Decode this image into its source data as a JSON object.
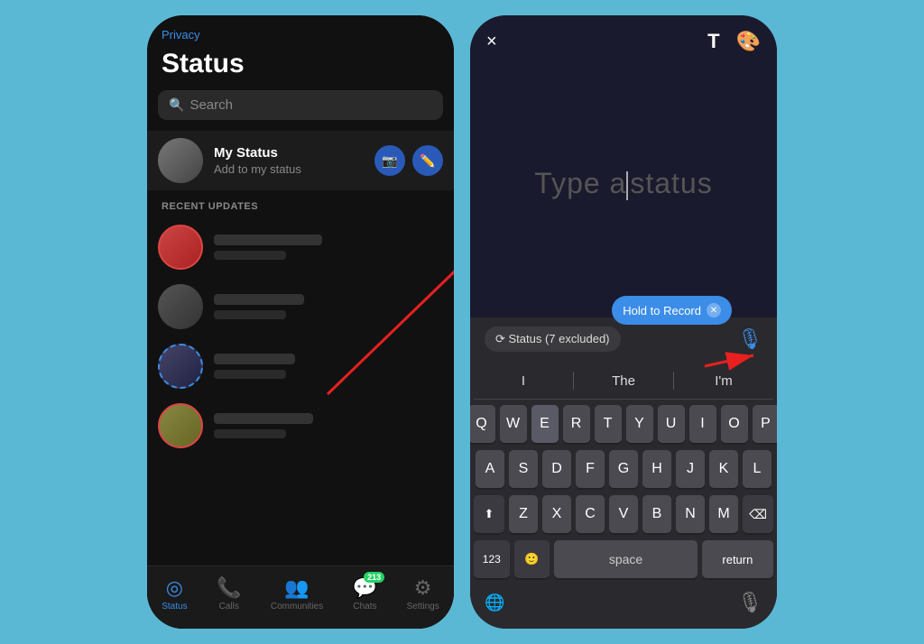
{
  "left_phone": {
    "privacy_label": "Privacy",
    "title": "Status",
    "search_placeholder": "Search",
    "my_status": {
      "name": "My Status",
      "sub": "Add to my status"
    },
    "section_label": "RECENT UPDATES",
    "updates": [
      {
        "id": 1,
        "ring": "pink"
      },
      {
        "id": 2,
        "ring": "none"
      },
      {
        "id": 3,
        "ring": "blue"
      },
      {
        "id": 4,
        "ring": "pink"
      }
    ],
    "nav": {
      "items": [
        {
          "label": "Status",
          "active": true,
          "icon": "◎"
        },
        {
          "label": "Calls",
          "active": false,
          "icon": "📞"
        },
        {
          "label": "Communities",
          "active": false,
          "icon": "👥"
        },
        {
          "label": "Chats",
          "active": false,
          "icon": "💬",
          "badge": "213"
        },
        {
          "label": "Settings",
          "active": false,
          "icon": "⚙"
        }
      ]
    }
  },
  "right_phone": {
    "close_label": "×",
    "text_label": "T",
    "palette_label": "🎨",
    "placeholder_text": "Type a",
    "placeholder_text2": "status",
    "hold_to_record": "Hold to Record",
    "status_excluded": "⟳ Status (7 excluded)",
    "word_suggestions": [
      "I",
      "The",
      "I'm"
    ],
    "keyboard_rows": [
      [
        "Q",
        "W",
        "E",
        "R",
        "T",
        "Y",
        "U",
        "I",
        "O",
        "P"
      ],
      [
        "A",
        "S",
        "D",
        "F",
        "G",
        "H",
        "J",
        "K",
        "L"
      ],
      [
        "⬆",
        "Z",
        "X",
        "C",
        "V",
        "B",
        "N",
        "M",
        "⌫"
      ],
      [
        "123",
        "🙂",
        "space",
        "return"
      ]
    ]
  }
}
